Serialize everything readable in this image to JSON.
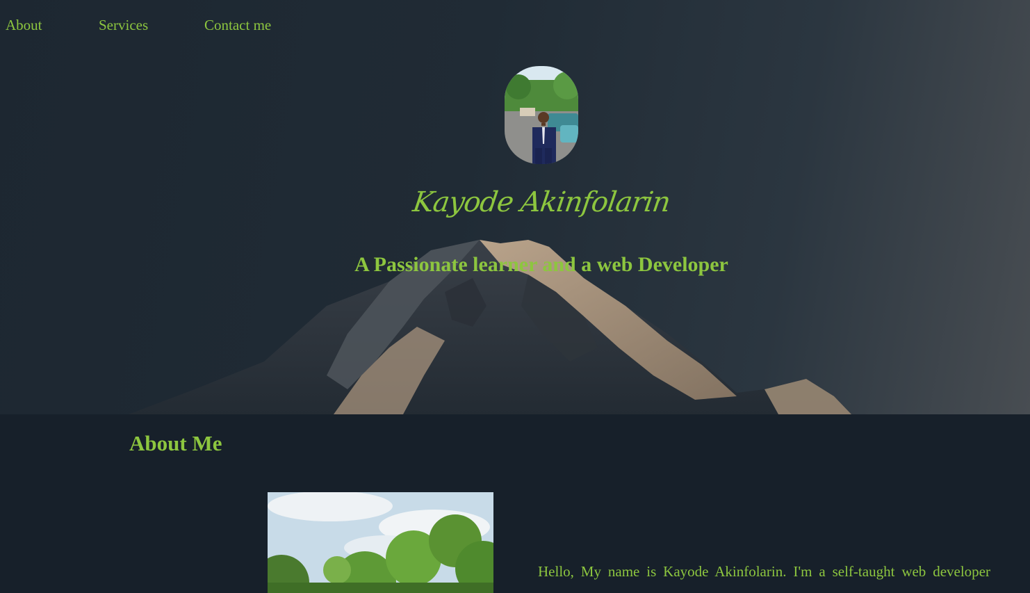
{
  "nav": {
    "items": [
      "About",
      "Services",
      "Contact me"
    ]
  },
  "hero": {
    "name": "Kayode Akinfolarin",
    "tagline": "A Passionate learner and a web Developer"
  },
  "about": {
    "heading": "About Me",
    "text": "Hello, My name is Kayode Akinfolarin. I'm a self-taught web developer"
  },
  "colors": {
    "accent": "#8dc63f",
    "background": "#17202a"
  }
}
